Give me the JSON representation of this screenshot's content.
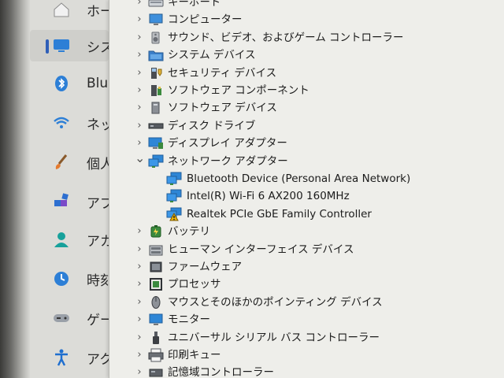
{
  "settings": {
    "items": [
      {
        "label": "ホー",
        "icon": "home-icon"
      },
      {
        "label": "シス",
        "icon": "system-icon"
      },
      {
        "label": "Blu",
        "icon": "bluetooth-icon"
      },
      {
        "label": "ネッ",
        "icon": "wifi-icon"
      },
      {
        "label": "個人",
        "icon": "brush-icon"
      },
      {
        "label": "アプ",
        "icon": "apps-icon"
      },
      {
        "label": "アカ",
        "icon": "account-icon"
      },
      {
        "label": "時刻",
        "icon": "clock-icon"
      },
      {
        "label": "ゲー",
        "icon": "gamepad-icon"
      },
      {
        "label": "アク",
        "icon": "accessibility-icon"
      }
    ]
  },
  "device_manager": {
    "categories": [
      {
        "label": "キーボード",
        "icon": "keyboard-icon",
        "expanded": false
      },
      {
        "label": "コンピューター",
        "icon": "computer-icon",
        "expanded": false
      },
      {
        "label": "サウンド、ビデオ、およびゲーム コントローラー",
        "icon": "speaker-icon",
        "expanded": false
      },
      {
        "label": "システム デバイス",
        "icon": "folder-icon",
        "expanded": false
      },
      {
        "label": "セキュリティ デバイス",
        "icon": "security-device-icon",
        "expanded": false
      },
      {
        "label": "ソフトウェア コンポーネント",
        "icon": "software-component-icon",
        "expanded": false
      },
      {
        "label": "ソフトウェア デバイス",
        "icon": "software-device-icon",
        "expanded": false
      },
      {
        "label": "ディスク ドライブ",
        "icon": "disk-drive-icon",
        "expanded": false
      },
      {
        "label": "ディスプレイ アダプター",
        "icon": "display-adapter-icon",
        "expanded": false
      },
      {
        "label": "ネットワーク アダプター",
        "icon": "network-adapter-icon",
        "expanded": true,
        "children": [
          {
            "label": "Bluetooth Device (Personal Area Network)",
            "icon": "network-adapter-icon",
            "warning": false
          },
          {
            "label": "Intel(R) Wi-Fi 6 AX200 160MHz",
            "icon": "network-adapter-icon",
            "warning": false
          },
          {
            "label": "Realtek PCIe GbE Family Controller",
            "icon": "network-adapter-warning-icon",
            "warning": true
          }
        ]
      },
      {
        "label": "バッテリ",
        "icon": "battery-icon",
        "expanded": false
      },
      {
        "label": "ヒューマン インターフェイス デバイス",
        "icon": "hid-icon",
        "expanded": false
      },
      {
        "label": "ファームウェア",
        "icon": "firmware-icon",
        "expanded": false
      },
      {
        "label": "プロセッサ",
        "icon": "processor-icon",
        "expanded": false
      },
      {
        "label": "マウスとそのほかのポインティング デバイス",
        "icon": "mouse-icon",
        "expanded": false
      },
      {
        "label": "モニター",
        "icon": "monitor-icon",
        "expanded": false
      },
      {
        "label": "ユニバーサル シリアル バス コントローラー",
        "icon": "usb-icon",
        "expanded": false
      },
      {
        "label": "印刷キュー",
        "icon": "printer-icon",
        "expanded": false
      },
      {
        "label": "記憶域コントローラー",
        "icon": "storage-controller-icon",
        "expanded": false
      }
    ]
  },
  "colors": {
    "accent": "#2f5fb8",
    "warning": "#f0b400",
    "monitor_blue": "#2e86d6"
  }
}
